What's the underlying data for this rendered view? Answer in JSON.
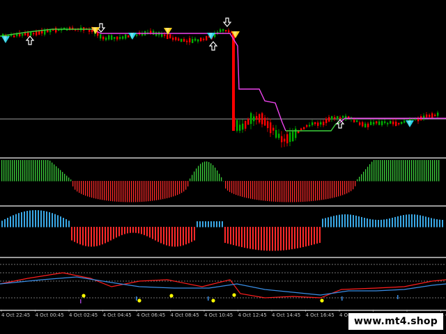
{
  "chart": {
    "background": "#000000",
    "colors": {
      "bull_candle": "#00b000",
      "bear_candle": "#ff0000",
      "ma_green": "#3cd23c",
      "ma_magenta": "#ee44ee",
      "hist_green": "#3cd23c",
      "hist_red": "#ff2a2a",
      "hist_blue": "#3aa8e6",
      "osc_red": "#ff1e1e",
      "osc_blue": "#3a8ee6",
      "signal_yellow": "#ffff00",
      "arrow_yellow": "#ffd21e",
      "arrow_cyan": "#2ad2e6",
      "arrow_white": "#ffffff",
      "panel_separator": "#9a9a9a"
    },
    "time_labels": [
      "4 Oct 22:45",
      "4 Oct 00:45",
      "4 Oct 02:45",
      "4 Oct 04:45",
      "4 Oct 06:45",
      "4 Oct 08:45",
      "4 Oct 10:45",
      "4 Oct 12:45",
      "4 Oct 14:45",
      "4 Oct 16:45",
      "4 Oct 18:45",
      "4 Oct 20:45",
      "4 Oct 22:45",
      "4 Oct 04:45"
    ],
    "icons": {
      "arrow_up": "up-arrow-icon",
      "arrow_down": "down-arrow-icon",
      "signal_triangle": "triangle-marker-icon",
      "signal_dot": "dot-marker-icon"
    }
  },
  "watermark": {
    "text": "www.mt4.shop"
  }
}
